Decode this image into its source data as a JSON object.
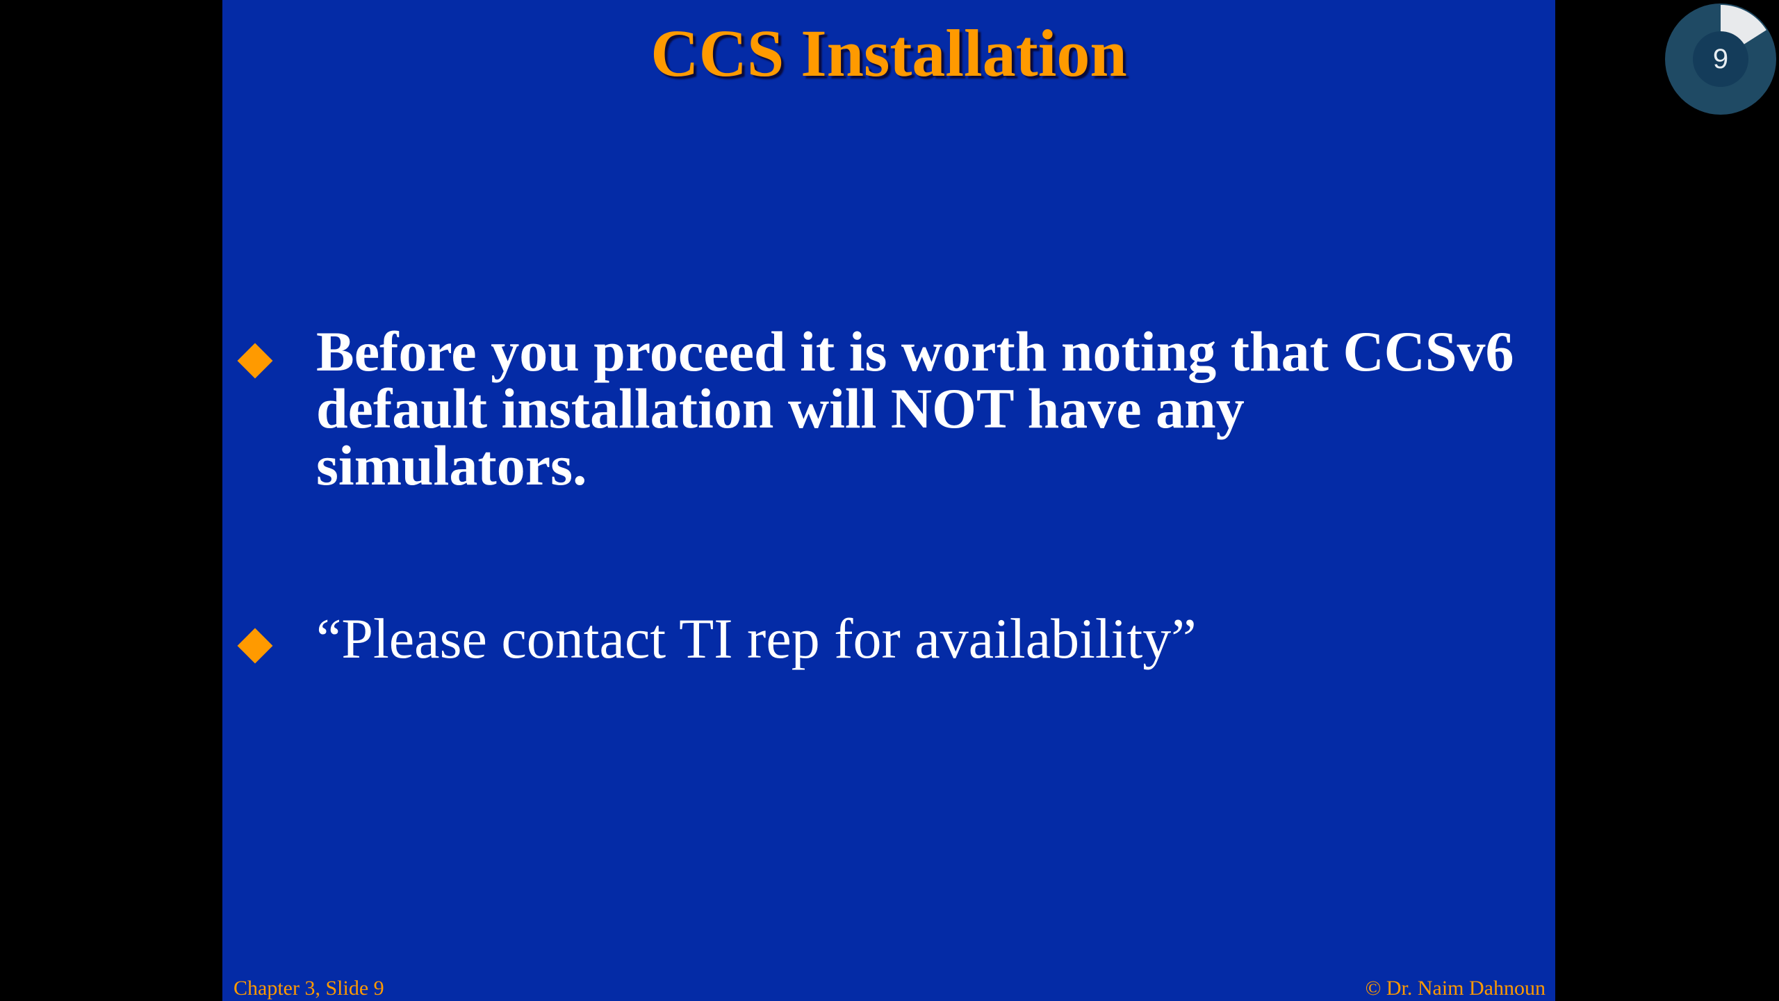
{
  "slide": {
    "title": "CCS Installation",
    "bullets": [
      {
        "text": "Before you proceed it is worth noting that CCSv6 default installation will NOT have any simulators."
      },
      {
        "text": "“Please contact TI rep for availability”"
      }
    ],
    "footer_left": "Chapter 3, Slide 9",
    "footer_right": "© Dr. Naim Dahnoun"
  },
  "progress": {
    "number": "9",
    "fraction": 0.16
  },
  "colors": {
    "slide_background": "#042ba6",
    "accent": "#ff9a00",
    "text": "#ffffff",
    "widget_ring": "#1f4a64",
    "widget_progress": "#e8eaec",
    "widget_center": "#143c5a"
  }
}
